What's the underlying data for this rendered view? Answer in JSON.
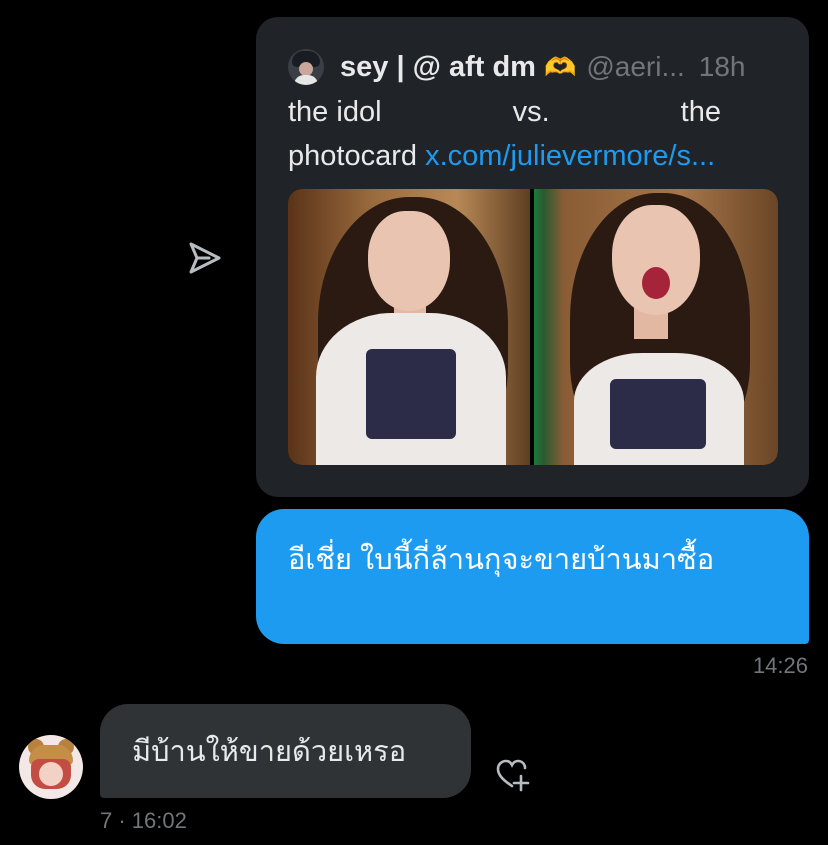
{
  "quoted_tweet": {
    "author_name": "sey | @ aft dm",
    "author_emoji": "🫶",
    "handle": "@aeri...",
    "time": "18h",
    "text_words": [
      "the idol",
      "vs.",
      "the"
    ],
    "text_line2": "photocard",
    "link": "x.com/julievermore/s..."
  },
  "messages": [
    {
      "direction": "sent",
      "text": "อีเชี่ย ใบนี้กี่ล้านกุจะขายบ้านมาซื้อ",
      "time": "14:26"
    },
    {
      "direction": "received",
      "text": "มีบ้านให้ขายด้วยเหรอ",
      "meta": "7 · 16:02"
    }
  ],
  "colors": {
    "background": "#000000",
    "sent_bubble": "#1d9bf0",
    "received_bubble": "#2f3336",
    "card": "#202327",
    "muted": "#71767b"
  },
  "icons": [
    "share-icon",
    "add-reaction-icon"
  ]
}
